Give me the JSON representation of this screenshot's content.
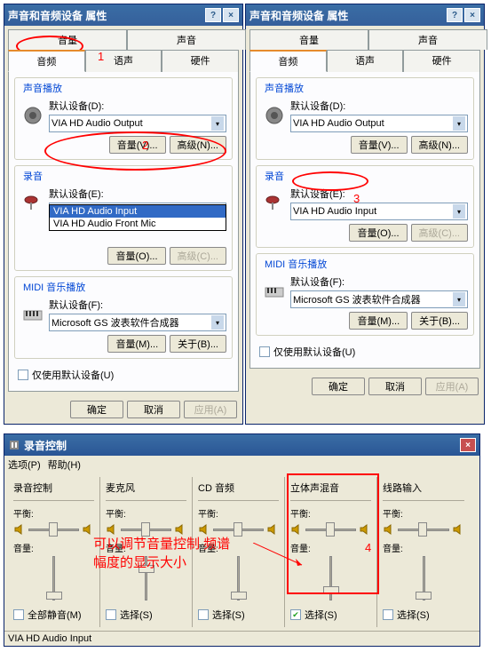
{
  "dialog_title": "声音和音频设备 属性",
  "help_btn": "?",
  "close_btn": "×",
  "tabs_row1": [
    "音量",
    "声音"
  ],
  "tabs_row2": [
    "音频",
    "语声",
    "硬件"
  ],
  "playback": {
    "legend": "声音播放",
    "label": "默认设备(D):",
    "device": "VIA HD Audio Output",
    "vol_btn": "音量(V)...",
    "adv_btn": "高级(N)..."
  },
  "record": {
    "legend": "录音",
    "label": "默认设备(E):",
    "device": "VIA HD Audio Input",
    "device_alt": "VIA HD Audio Front Mic",
    "vol_btn": "音量(O)...",
    "adv_btn": "高级(C)..."
  },
  "midi": {
    "legend": "MIDI 音乐播放",
    "label": "默认设备(F):",
    "device": "Microsoft GS 波表软件合成器",
    "vol_btn": "音量(M)...",
    "about_btn": "关于(B)..."
  },
  "only_default": "仅使用默认设备(U)",
  "ok_btn": "确定",
  "cancel_btn": "取消",
  "apply_btn": "应用(A)",
  "anno": {
    "n1": "1",
    "n2": "2",
    "n3": "3",
    "n4": "4"
  },
  "rec": {
    "title": "录音控制",
    "menu1": "选项(P)",
    "menu2": "帮助(H)",
    "cols": [
      {
        "title": "录音控制",
        "mute_label": "全部静音(M)",
        "checked": false,
        "thumb": 40
      },
      {
        "title": "麦克风",
        "mute_label": "选择(S)",
        "checked": false,
        "thumb": 10
      },
      {
        "title": "CD 音频",
        "mute_label": "选择(S)",
        "checked": false,
        "thumb": 40
      },
      {
        "title": "立体声混音",
        "mute_label": "选择(S)",
        "checked": true,
        "thumb": 34
      },
      {
        "title": "线路输入",
        "mute_label": "选择(S)",
        "checked": false,
        "thumb": 40
      }
    ],
    "balance_label": "平衡:",
    "volume_label": "音量:",
    "status": "VIA HD Audio Input",
    "note": "可以调节音量控制 频谱\n幅度的显示大小"
  }
}
